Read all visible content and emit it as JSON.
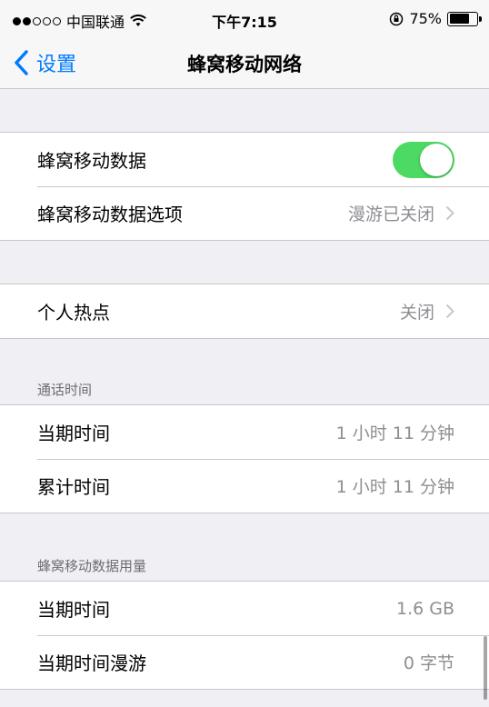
{
  "status_bar": {
    "carrier": "中国联通",
    "time": "下午7:15",
    "battery_percent": "75%",
    "battery_level": 0.75,
    "icons": [
      "signal-dots",
      "wifi-icon",
      "orientation-lock-icon",
      "battery-icon"
    ]
  },
  "nav": {
    "back_label": "设置",
    "title": "蜂窝移动网络"
  },
  "group1": {
    "cellular_data_label": "蜂窝移动数据",
    "cellular_data_on": true,
    "data_options_label": "蜂窝移动数据选项",
    "data_options_value": "漫游已关闭"
  },
  "group2": {
    "hotspot_label": "个人热点",
    "hotspot_value": "关闭"
  },
  "call_time": {
    "header": "通话时间",
    "rows": [
      {
        "label": "当期时间",
        "value": "1 小时 11 分钟"
      },
      {
        "label": "累计时间",
        "value": "1 小时 11 分钟"
      }
    ]
  },
  "usage": {
    "header": "蜂窝移动数据用量",
    "rows": [
      {
        "label": "当期时间",
        "value": "1.6 GB"
      },
      {
        "label": "当期时间漫游",
        "value": "0 字节"
      }
    ]
  },
  "colors": {
    "accent": "#007aff",
    "toggle_on": "#4cd964",
    "background": "#efeff4",
    "secondary_text": "#8e8e93"
  }
}
